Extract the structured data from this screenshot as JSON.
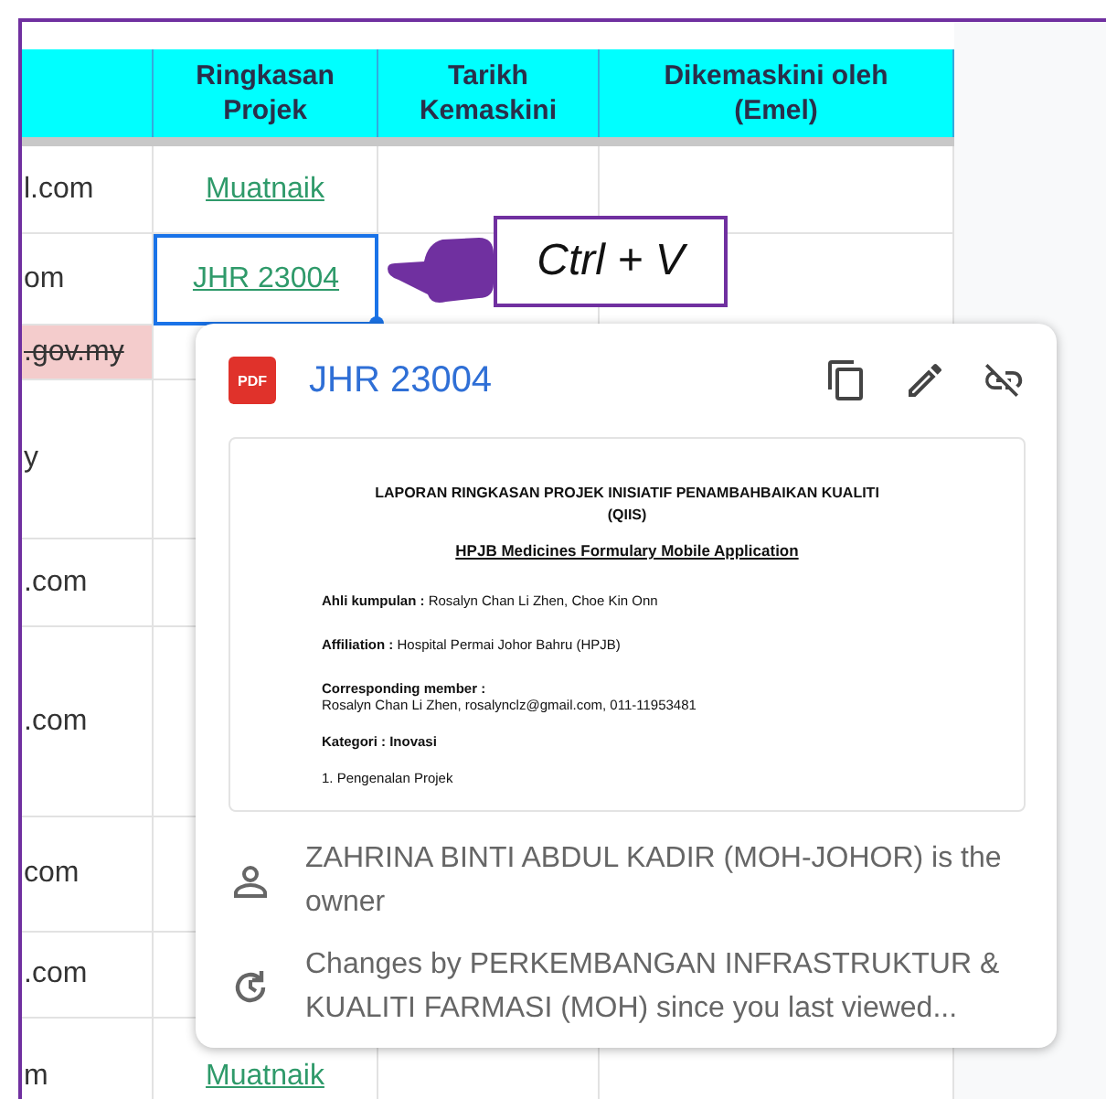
{
  "table": {
    "columns": [
      {
        "label": "Ringkasan Projek"
      },
      {
        "label": "Tarikh Kemaskini"
      },
      {
        "label": "Dikemaskini oleh (Emel)"
      }
    ],
    "rows": [
      {
        "column_1": "l.com",
        "summary": "Muatnaik",
        "selected": false,
        "deleted": false
      },
      {
        "column_1": "om",
        "summary": "JHR 23004",
        "selected": true,
        "deleted": false
      },
      {
        "column_1": ".gov.my",
        "summary": "",
        "selected": false,
        "deleted": true
      },
      {
        "column_1": "y",
        "summary": "",
        "selected": false,
        "deleted": false
      },
      {
        "column_1": ".com",
        "summary": "",
        "selected": false,
        "deleted": false
      },
      {
        "column_1": ".com",
        "summary": "",
        "selected": false,
        "deleted": false
      },
      {
        "column_1": "com",
        "summary": "",
        "selected": false,
        "deleted": false
      },
      {
        "column_1": ".com",
        "summary": "",
        "selected": false,
        "deleted": false
      },
      {
        "column_1": "m",
        "summary": "Muatnaik",
        "selected": false,
        "deleted": false
      }
    ]
  },
  "callout": {
    "text": "Ctrl + V"
  },
  "link_preview": {
    "file_type": "PDF",
    "title": "JHR 23004",
    "preview": {
      "heading": "LAPORAN RINGKASAN PROJEK INISIATIF PENAMBAHBAIKAN KUALITI (QIIS)",
      "subtitle": "HPJB Medicines Formulary Mobile Application",
      "paragraphs": [
        "**Ahli kumpulan :** Rosalyn Chan Li Zhen, Choe Kin Onn",
        "**Affiliation :** Hospital Permai Johor Bahru (HPJB)",
        "**Corresponding member :**",
        "Rosalyn Chan Li Zhen, rosalynclz@gmail.com, 011-11953481",
        "**Kategori : Inovasi**",
        "1.  Pengenalan Projek"
      ]
    },
    "details": [
      {
        "kind": "owner",
        "text": "ZAHRINA BINTI ABDUL KADIR (MOH-JOHOR) is the owner"
      },
      {
        "kind": "changes",
        "text": "Changes by PERKEMBANGAN INFRASTRUKTUR & KUALITI FARMASI (MOH) since you last viewed..."
      }
    ]
  }
}
